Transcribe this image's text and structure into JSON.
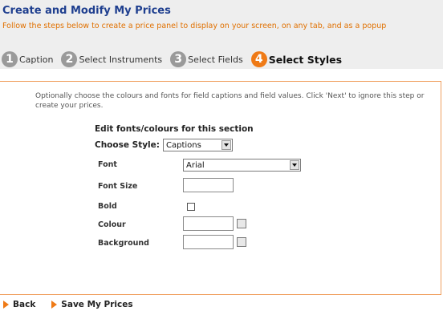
{
  "header": {
    "title": "Create and Modify My Prices",
    "subtitle": "Follow the steps below to create a price panel to display on your screen, on any tab, and as a popup"
  },
  "steps": [
    {
      "number": "1",
      "label": "Caption"
    },
    {
      "number": "2",
      "label": "Select Instruments"
    },
    {
      "number": "3",
      "label": "Select Fields"
    },
    {
      "number": "4",
      "label": "Select Styles"
    }
  ],
  "colors": {
    "accent": "#ef7a16",
    "title": "#1f3f8f",
    "inactive_step": "#9a9a9a"
  },
  "main": {
    "intro": "Optionally choose the colours and fonts for field captions and field values. Click 'Next' to ignore this step or create your prices.",
    "section_title": "Edit fonts/colours for this section",
    "choose_style_label": "Choose Style:",
    "style_value": "Captions",
    "font_label": "Font",
    "font_value": "Arial",
    "font_size_label": "Font Size",
    "bold_label": "Bold",
    "colour_label": "Colour",
    "background_label": "Background"
  },
  "footer": {
    "back_label": "Back",
    "save_label": "Save My Prices"
  }
}
